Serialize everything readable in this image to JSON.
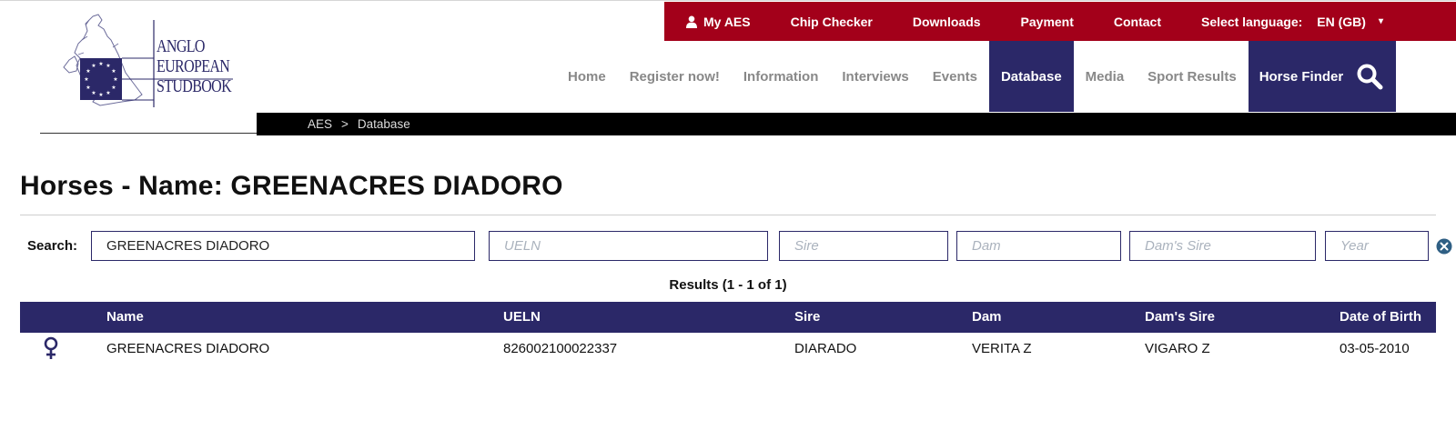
{
  "logo": {
    "lines": [
      "ANGLO",
      "EUROPEAN",
      "STUDBOOK"
    ]
  },
  "util_nav": {
    "items": [
      {
        "label": "My AES",
        "icon": "user-icon"
      },
      {
        "label": "Chip Checker"
      },
      {
        "label": "Downloads"
      },
      {
        "label": "Payment"
      },
      {
        "label": "Contact"
      }
    ],
    "language_label": "Select language:",
    "language_value": "EN (GB)"
  },
  "main_nav": {
    "items": [
      {
        "label": "Home"
      },
      {
        "label": "Register now!"
      },
      {
        "label": "Information"
      },
      {
        "label": "Interviews"
      },
      {
        "label": "Events"
      },
      {
        "label": "Database",
        "active": true
      },
      {
        "label": "Media"
      },
      {
        "label": "Sport Results"
      },
      {
        "label": "Horse Finder",
        "icon": "search-icon"
      }
    ]
  },
  "breadcrumb": {
    "items": [
      "AES",
      "Database"
    ],
    "separator": ">"
  },
  "page": {
    "title": "Horses - Name: GREENACRES DIADORO"
  },
  "search": {
    "label": "Search:",
    "name_value": "GREENACRES DIADORO",
    "ueln_placeholder": "UELN",
    "sire_placeholder": "Sire",
    "dam_placeholder": "Dam",
    "damsire_placeholder": "Dam's Sire",
    "year_placeholder": "Year"
  },
  "results": {
    "summary": "Results (1 - 1 of 1)"
  },
  "table": {
    "columns": [
      "Name",
      "UELN",
      "Sire",
      "Dam",
      "Dam's Sire",
      "Date of Birth"
    ],
    "rows": [
      {
        "sex_icon": "female-icon",
        "name": "GREENACRES DIADORO",
        "ueln": "826002100022337",
        "sire": "DIARADO",
        "dam": "VERITA Z",
        "dam_sire": "VIGARO Z",
        "dob": "03-05-2010"
      }
    ]
  },
  "colors": {
    "brand_navy": "#2b2868",
    "utility_red": "#a3001a",
    "breadcrumb_bg": "#000000",
    "nav_inactive": "#888888"
  }
}
